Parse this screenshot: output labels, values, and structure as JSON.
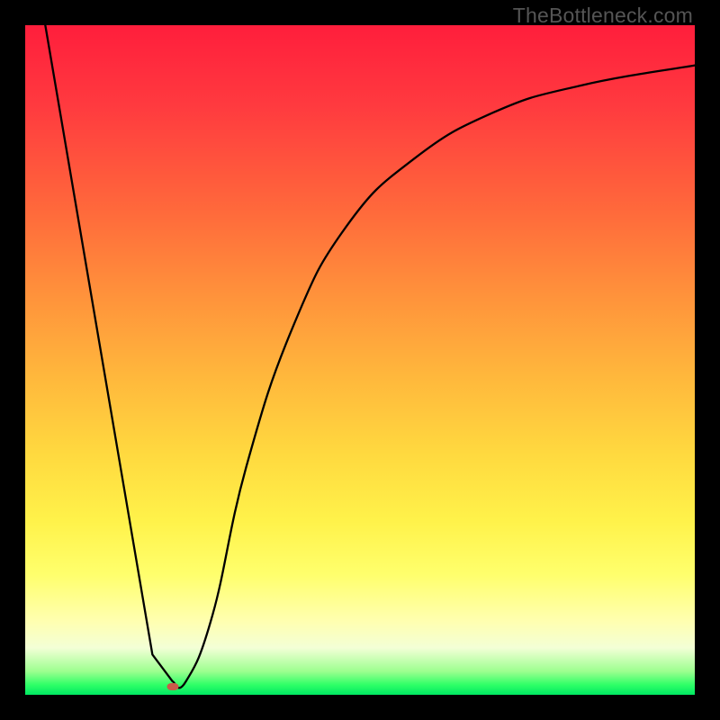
{
  "watermark": "TheBottleneck.com",
  "colors": {
    "frame": "#000000",
    "gradient_top": "#ff1e3c",
    "gradient_bottom": "#00e862",
    "curve": "#000000",
    "min_marker": "#c95a4a",
    "watermark_text": "#555555"
  },
  "chart_data": {
    "type": "line",
    "title": "",
    "xlabel": "",
    "ylabel": "",
    "xlim": [
      0,
      100
    ],
    "ylim": [
      0,
      100
    ],
    "series": [
      {
        "name": "bottleneck-curve",
        "x": [
          3,
          19,
          22,
          24,
          28,
          33,
          40,
          48,
          58,
          70,
          83,
          100
        ],
        "y": [
          100,
          6,
          2,
          2,
          12,
          34,
          55,
          70,
          80,
          87,
          91,
          94
        ]
      }
    ],
    "annotations": [
      {
        "name": "minimum-marker",
        "x": 22,
        "y": 1.2
      }
    ],
    "notes": "Axes are unlabeled in the source image; values are estimated on a 0–100 scale from pixel positions. Background is a red→green vertical gradient, not a y-axis series."
  }
}
